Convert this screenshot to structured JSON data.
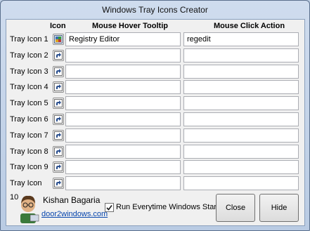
{
  "window": {
    "title": "Windows Tray Icons Creator"
  },
  "headers": {
    "icon": "Icon",
    "tooltip": "Mouse Hover Tooltip",
    "action": "Mouse Click Action"
  },
  "rows": [
    {
      "label": "Tray Icon 1",
      "tooltip": "Registry Editor",
      "action": "regedit",
      "icon": "registry-editor-icon"
    },
    {
      "label": "Tray Icon 2",
      "tooltip": "",
      "action": "",
      "icon": "shortcut-arrow-icon"
    },
    {
      "label": "Tray Icon 3",
      "tooltip": "",
      "action": "",
      "icon": "shortcut-arrow-icon"
    },
    {
      "label": "Tray Icon 4",
      "tooltip": "",
      "action": "",
      "icon": "shortcut-arrow-icon"
    },
    {
      "label": "Tray Icon 5",
      "tooltip": "",
      "action": "",
      "icon": "shortcut-arrow-icon"
    },
    {
      "label": "Tray Icon 6",
      "tooltip": "",
      "action": "",
      "icon": "shortcut-arrow-icon"
    },
    {
      "label": "Tray Icon 7",
      "tooltip": "",
      "action": "",
      "icon": "shortcut-arrow-icon"
    },
    {
      "label": "Tray Icon 8",
      "tooltip": "",
      "action": "",
      "icon": "shortcut-arrow-icon"
    },
    {
      "label": "Tray Icon 9",
      "tooltip": "",
      "action": "",
      "icon": "shortcut-arrow-icon"
    },
    {
      "label": "Tray Icon 10",
      "tooltip": "",
      "action": "",
      "icon": "shortcut-arrow-icon"
    }
  ],
  "footer": {
    "author": "Kishan Bagaria",
    "website": "door2windows.com",
    "startup_label": "Run Everytime Windows Starts Up",
    "startup_checked": true,
    "close_label": "Close",
    "hide_label": "Hide"
  }
}
